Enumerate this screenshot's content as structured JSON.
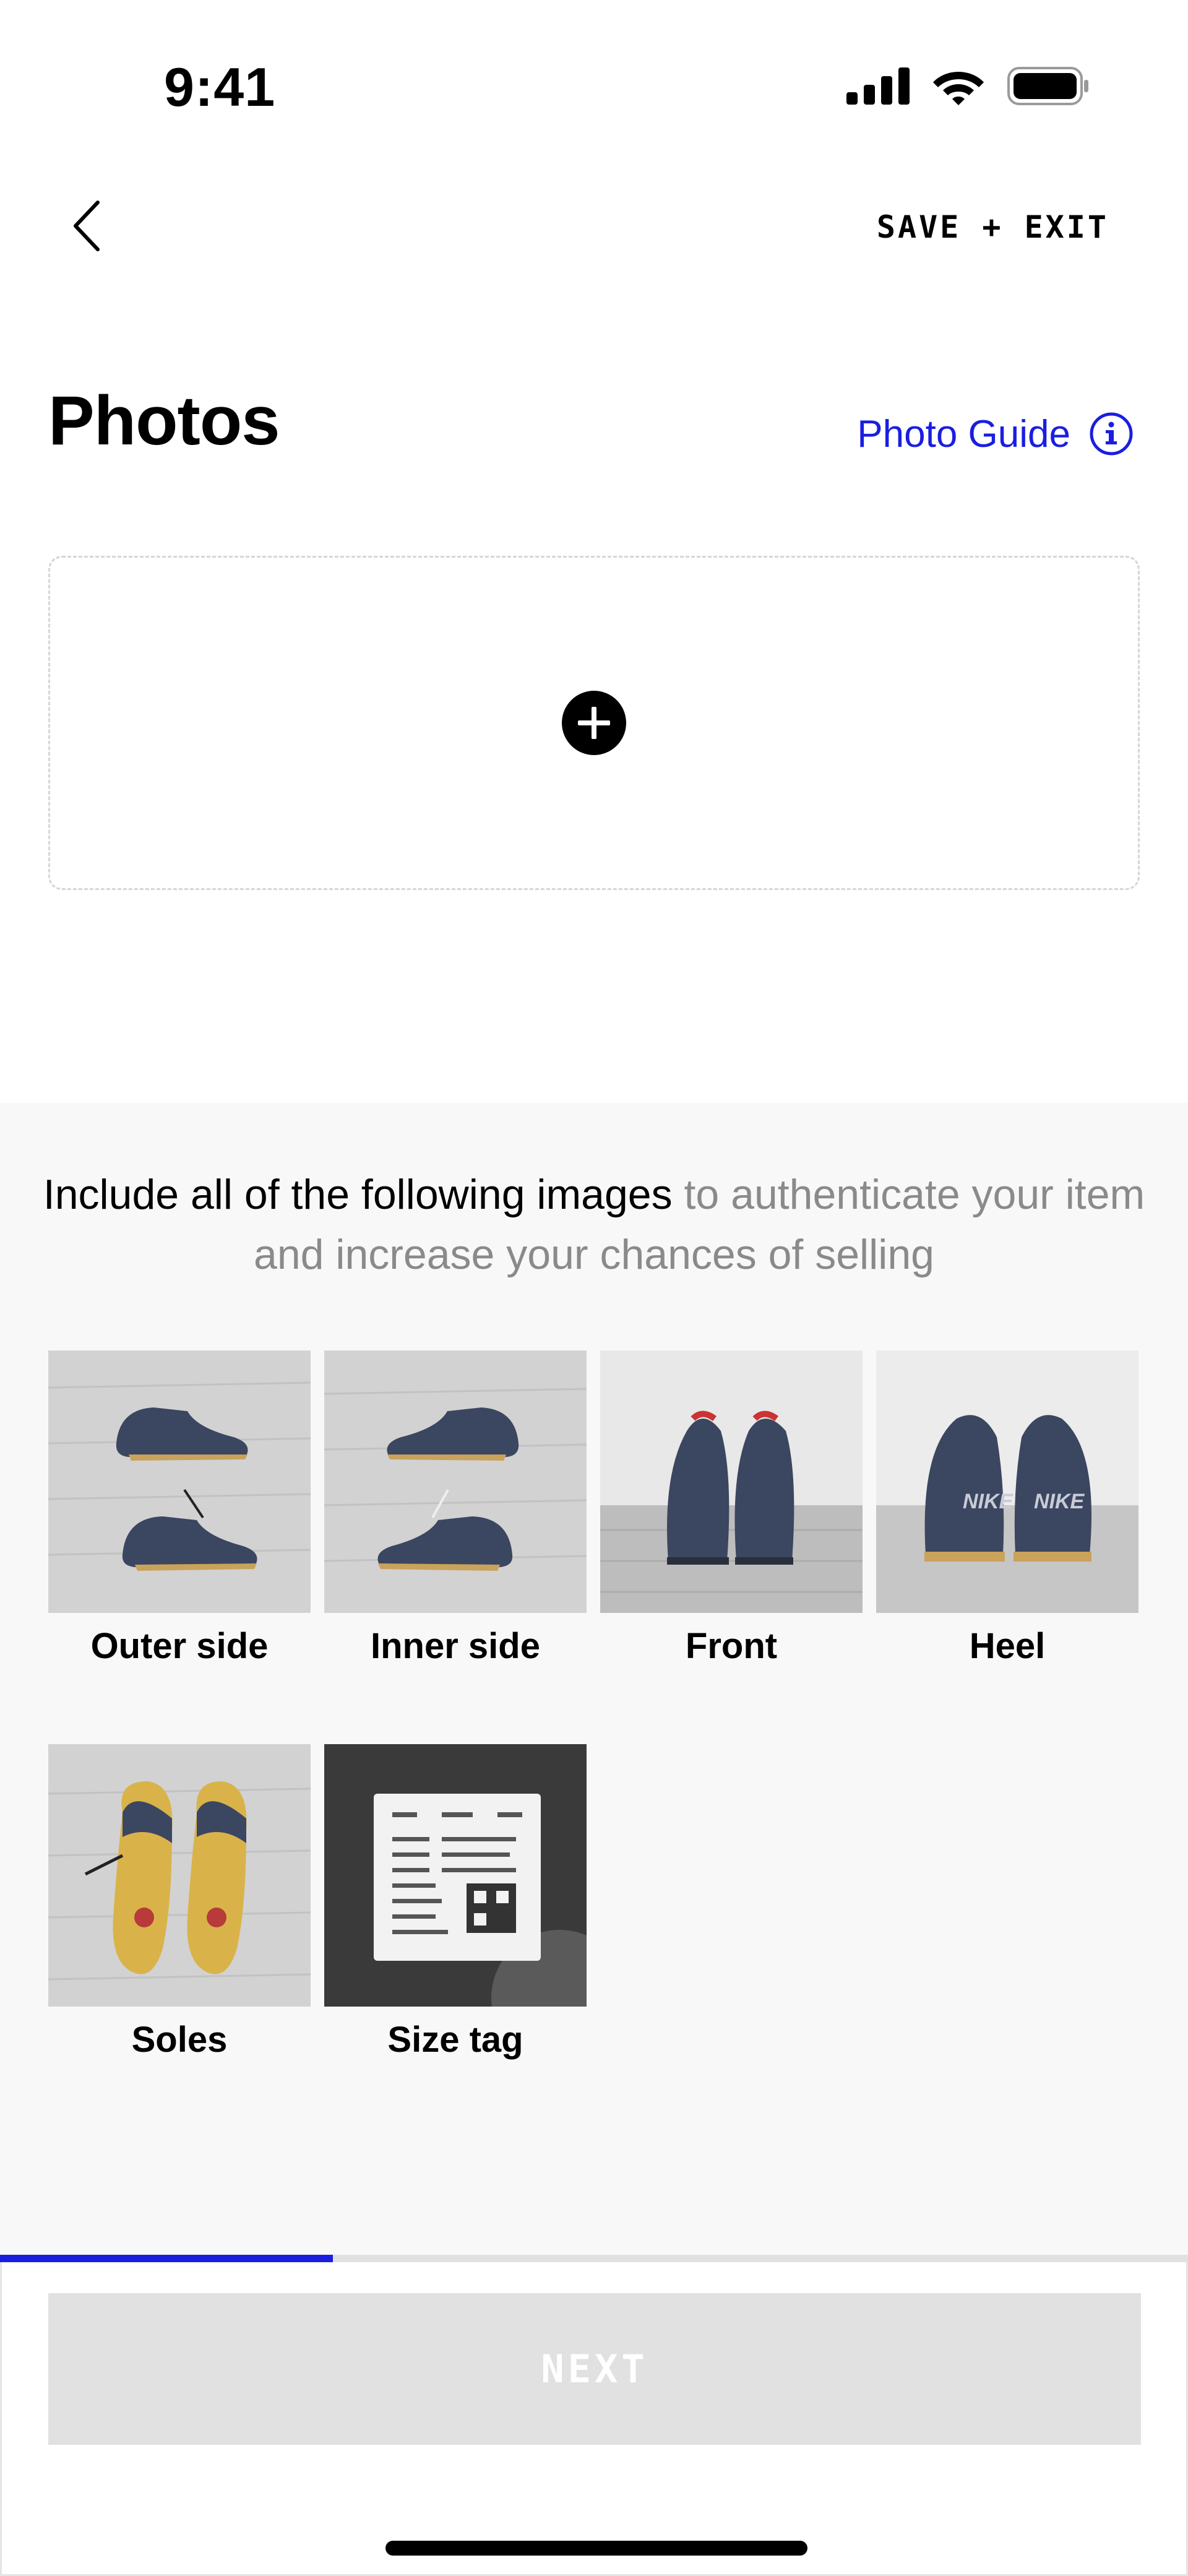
{
  "status_bar": {
    "time": "9:41"
  },
  "nav": {
    "save_exit_label": "SAVE + EXIT"
  },
  "page": {
    "title": "Photos"
  },
  "photo_guide": {
    "label": "Photo Guide"
  },
  "checklist": {
    "instruction_main": "Include all of the following images",
    "instruction_muted": " to authenticate your item and increase your chances of selling",
    "items": [
      {
        "label": "Outer side"
      },
      {
        "label": "Inner side"
      },
      {
        "label": "Front"
      },
      {
        "label": "Heel"
      },
      {
        "label": "Soles"
      },
      {
        "label": "Size tag"
      }
    ]
  },
  "progress": {
    "fraction": 0.28
  },
  "footer": {
    "next_label": "NEXT"
  },
  "colors": {
    "accent": "#1a1ee0",
    "muted_text": "#8a8a8a",
    "disabled_button": "#e1e1e1",
    "section_bg": "#f8f8f8"
  },
  "icons": [
    "back-chevron-icon",
    "cellular-signal-icon",
    "wifi-icon",
    "battery-icon",
    "info-icon",
    "add-photo-icon"
  ]
}
